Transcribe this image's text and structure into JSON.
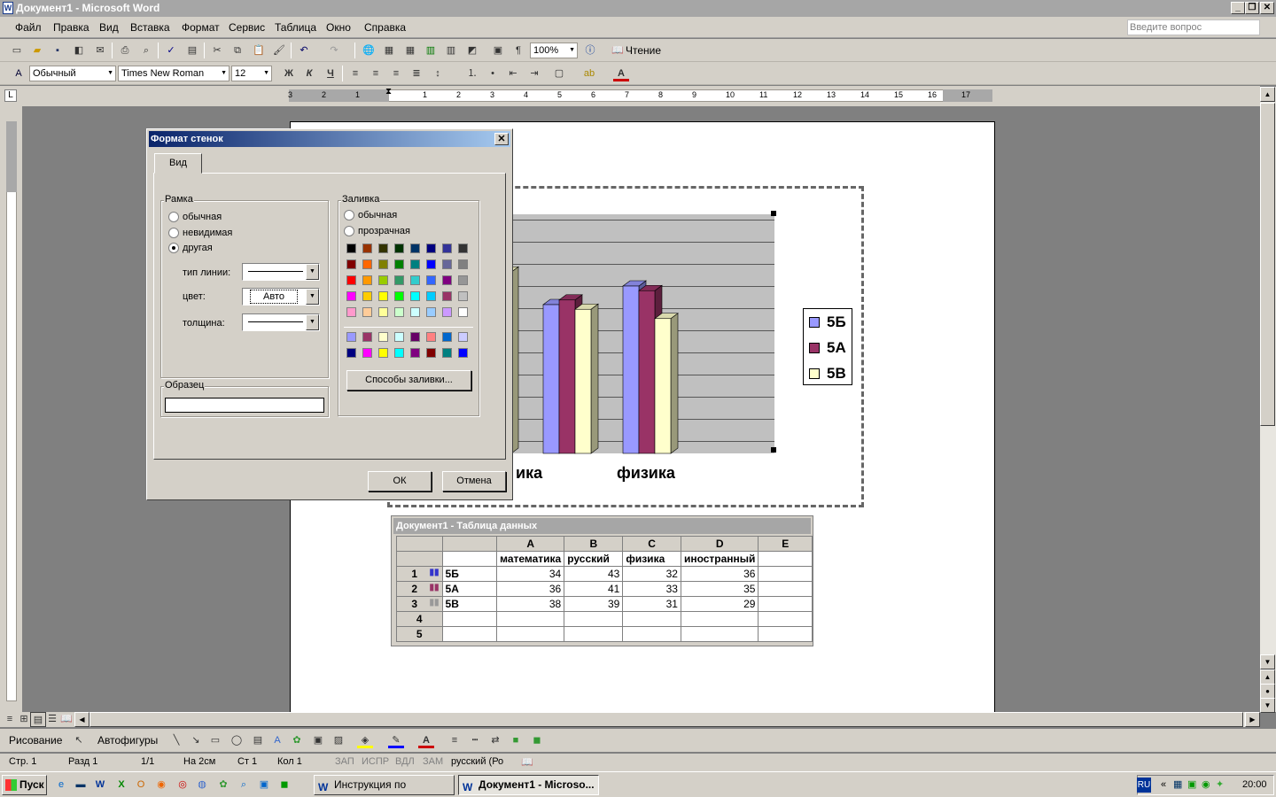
{
  "window": {
    "title": "Документ1 - Microsoft Word"
  },
  "menu": {
    "items": [
      "Файл",
      "Правка",
      "Вид",
      "Вставка",
      "Формат",
      "Сервис",
      "Таблица",
      "Окно",
      "Справка"
    ],
    "help_placeholder": "Введите вопрос"
  },
  "toolbar": {
    "zoom": "100%",
    "reading": "Чтение"
  },
  "format": {
    "style": "Обычный",
    "font": "Times New Roman",
    "size": "12"
  },
  "format_icons": {
    "bold": "Ж",
    "italic": "К",
    "underline": "Ч",
    "font_color": "A"
  },
  "ruler": {
    "labels": [
      "3",
      "2",
      "1",
      "1",
      "2",
      "3",
      "4",
      "5",
      "6",
      "7",
      "8",
      "9",
      "10",
      "11",
      "12",
      "13",
      "14",
      "15",
      "16",
      "17"
    ]
  },
  "chart": {
    "categories": [
      "ика",
      "физика"
    ],
    "legend": [
      "5Б",
      "5А",
      "5В"
    ],
    "colors": {
      "s1": "#9999ff",
      "s2": "#993366",
      "s3": "#ffffcc"
    }
  },
  "chart_data": {
    "type": "bar",
    "categories": [
      "математика",
      "русский",
      "физика",
      "иностранный"
    ],
    "series": [
      {
        "name": "5Б",
        "values": [
          34,
          43,
          32,
          36
        ]
      },
      {
        "name": "5А",
        "values": [
          36,
          41,
          33,
          35
        ]
      },
      {
        "name": "5В",
        "values": [
          38,
          39,
          31,
          29
        ]
      }
    ],
    "legend": "right"
  },
  "dialog": {
    "title": "Формат стенок",
    "tab": "Вид",
    "border": {
      "label": "Рамка",
      "options": [
        "обычная",
        "невидимая",
        "другая"
      ],
      "selected": 2,
      "line_type_label": "тип линии:",
      "color_label": "цвет:",
      "color_value": "Авто",
      "weight_label": "толщина:"
    },
    "sample_label": "Образец",
    "fill": {
      "label": "Заливка",
      "options": [
        "обычная",
        "прозрачная"
      ],
      "effects_button": "Способы заливки..."
    },
    "ok": "ОК",
    "cancel": "Отмена",
    "palette": [
      [
        "#000000",
        "#993300",
        "#333300",
        "#003300",
        "#003366",
        "#000080",
        "#333399",
        "#333333"
      ],
      [
        "#800000",
        "#ff6600",
        "#808000",
        "#008000",
        "#008080",
        "#0000ff",
        "#666699",
        "#808080"
      ],
      [
        "#ff0000",
        "#ff9900",
        "#99cc00",
        "#339966",
        "#33cccc",
        "#3366ff",
        "#800080",
        "#969696"
      ],
      [
        "#ff00ff",
        "#ffcc00",
        "#ffff00",
        "#00ff00",
        "#00ffff",
        "#00ccff",
        "#993366",
        "#c0c0c0"
      ],
      [
        "#ff99cc",
        "#ffcc99",
        "#ffff99",
        "#ccffcc",
        "#ccffff",
        "#99ccff",
        "#cc99ff",
        "#ffffff"
      ]
    ],
    "palette2": [
      [
        "#9999ff",
        "#993366",
        "#ffffcc",
        "#ccffff",
        "#660066",
        "#ff8080",
        "#0066cc",
        "#ccccff"
      ],
      [
        "#000080",
        "#ff00ff",
        "#ffff00",
        "#00ffff",
        "#800080",
        "#800000",
        "#008080",
        "#0000ff"
      ]
    ]
  },
  "datasheet": {
    "title": "Документ1 - Таблица данных",
    "cols": [
      "A",
      "B",
      "C",
      "D",
      "E"
    ],
    "headers": [
      "математика",
      "русский",
      "физика",
      "иностранный",
      ""
    ],
    "rows": [
      {
        "num": "1",
        "name": "5Б",
        "vals": [
          "34",
          "43",
          "32",
          "36",
          ""
        ]
      },
      {
        "num": "2",
        "name": "5А",
        "vals": [
          "36",
          "41",
          "33",
          "35",
          ""
        ]
      },
      {
        "num": "3",
        "name": "5В",
        "vals": [
          "38",
          "39",
          "31",
          "29",
          ""
        ]
      },
      {
        "num": "4",
        "name": "",
        "vals": [
          "",
          "",
          "",
          "",
          ""
        ]
      },
      {
        "num": "5",
        "name": "",
        "vals": [
          "",
          "",
          "",
          "",
          ""
        ]
      }
    ]
  },
  "drawing": {
    "draw": "Рисование",
    "autoshapes": "Автофигуры"
  },
  "status": {
    "page": "Стр. 1",
    "section": "Разд 1",
    "pages": "1/1",
    "at": "На 2см",
    "line": "Ст 1",
    "col": "Кол 1",
    "rec": "ЗАП",
    "trk": "ИСПР",
    "ext": "ВДЛ",
    "ovr": "ЗАМ",
    "lang": "русский (Ро"
  },
  "taskbar": {
    "start": "Пуск",
    "tasks": [
      "Инструкция по оформл...",
      "Документ1 - Microso..."
    ],
    "time": "20:00",
    "lang": "RU"
  }
}
